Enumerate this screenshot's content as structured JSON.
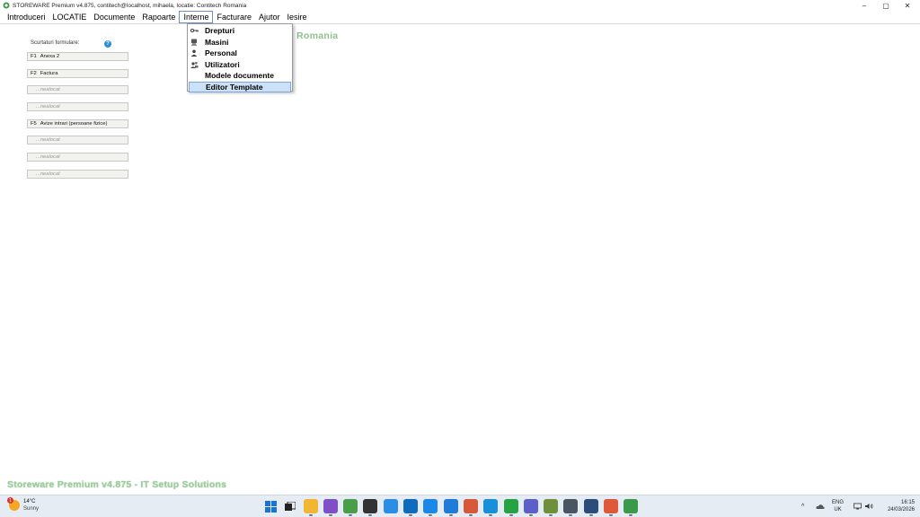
{
  "window": {
    "title": "STOREWARE Premium v4.875, contitech@localhost, mihaela, locatie: Contitech Romania",
    "controls": {
      "minimize": "–",
      "maximize": "▢",
      "close": "✕"
    }
  },
  "menubar": {
    "items": [
      {
        "label": "Introduceri"
      },
      {
        "label": "LOCATIE"
      },
      {
        "label": "Documente"
      },
      {
        "label": "Rapoarte"
      },
      {
        "label": "Interne"
      },
      {
        "label": "Facturare"
      },
      {
        "label": "Ajutor"
      },
      {
        "label": "Iesire"
      }
    ]
  },
  "dropdown": {
    "items": [
      {
        "label": "Drepturi",
        "icon": "key-icon"
      },
      {
        "label": "Masini",
        "icon": "computer-icon"
      },
      {
        "label": "Personal",
        "icon": "person-icon"
      },
      {
        "label": "Utilizatori",
        "icon": "users-icon"
      },
      {
        "label": "Modele documente",
        "icon": ""
      },
      {
        "label": "Editor Template",
        "icon": ""
      }
    ],
    "highlighted": "Editor Template"
  },
  "main": {
    "ghost_title": "Romania",
    "shortcuts_label": "Scurtaturi formulare:",
    "help_glyph": "?",
    "shortcuts": [
      {
        "key": "F1",
        "label": "Anexa 2"
      },
      {
        "key": "F2",
        "label": "Factura"
      },
      {
        "key": "",
        "label": "...nealocat"
      },
      {
        "key": "",
        "label": "...nealocat"
      },
      {
        "key": "F5",
        "label": "Avize intrari (persoane fizice)"
      },
      {
        "key": "",
        "label": "...nealocat"
      },
      {
        "key": "",
        "label": "...nealocat"
      },
      {
        "key": "",
        "label": "...nealocat"
      }
    ],
    "footer_brand": "Storeware Premium v4.875 - IT Setup Solutions"
  },
  "taskbar": {
    "weather": {
      "temp": "14°C",
      "condition": "Sunny",
      "badge": "1"
    },
    "apps": [
      {
        "name": "start-icon",
        "color": "#1a73d9"
      },
      {
        "name": "task-view-icon",
        "color": "#2b2b2b"
      },
      {
        "name": "file-explorer-icon",
        "color": "#f2b632"
      },
      {
        "name": "visual-studio-icon",
        "color": "#7e4fc6"
      },
      {
        "name": "chrome-icon",
        "color": "#4a9d4a"
      },
      {
        "name": "terminal-icon",
        "color": "#333333"
      },
      {
        "name": "vscode-icon",
        "color": "#2b8ee6"
      },
      {
        "name": "outlook-icon",
        "color": "#0f6cbd"
      },
      {
        "name": "chat-icon",
        "color": "#1b87e6"
      },
      {
        "name": "edge-icon",
        "color": "#1f7ad8"
      },
      {
        "name": "chrome-alt-icon",
        "color": "#d65a3a"
      },
      {
        "name": "network-icon",
        "color": "#1a8fd9"
      },
      {
        "name": "whatsapp-icon",
        "color": "#25a244"
      },
      {
        "name": "teams-icon",
        "color": "#5b5fc7"
      },
      {
        "name": "notepad-icon",
        "color": "#6f8f3a"
      },
      {
        "name": "calculator-icon",
        "color": "#4a5563"
      },
      {
        "name": "store-icon",
        "color": "#2c4d7a"
      },
      {
        "name": "snipping-icon",
        "color": "#e0583a"
      },
      {
        "name": "storeware-icon",
        "color": "#3a9a4a"
      }
    ],
    "tray": {
      "chevron": "^",
      "lang_line1": "ENG",
      "lang_line2": "UK",
      "time": "16:15",
      "date": "24/03/2026"
    }
  }
}
